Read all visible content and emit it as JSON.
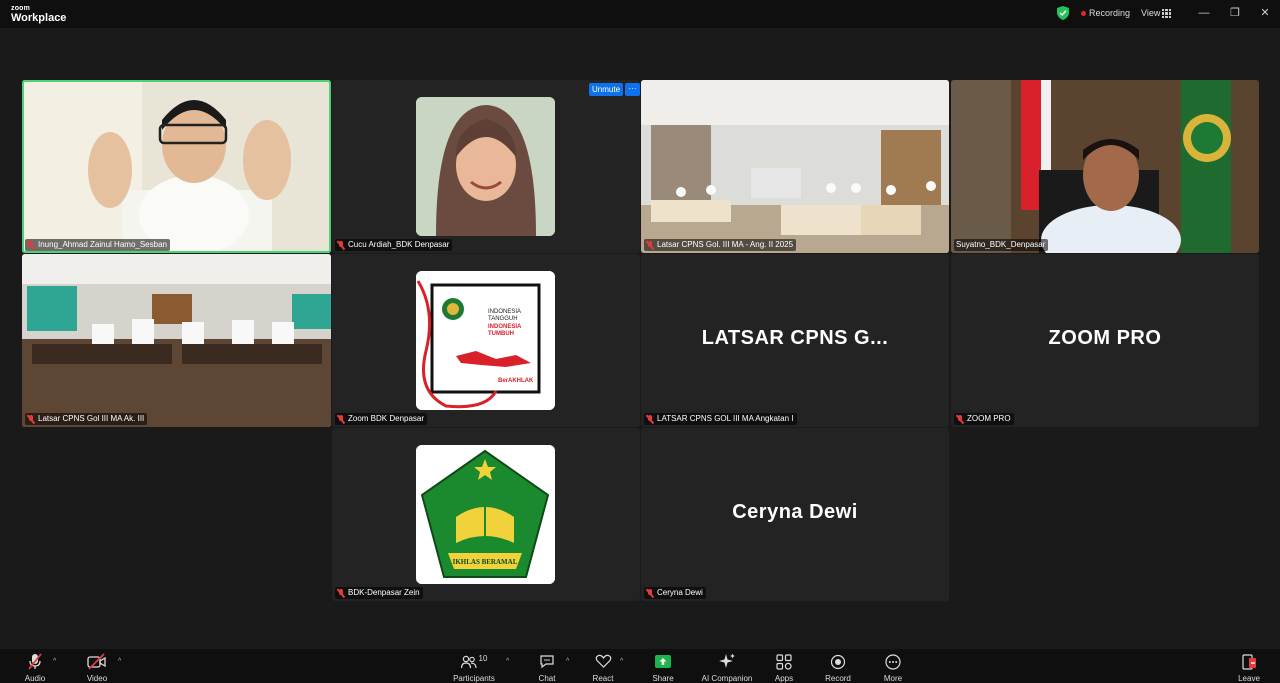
{
  "app": {
    "brand_small": "zoom",
    "brand_big": "Workplace"
  },
  "titlebar": {
    "recording_label": "Recording",
    "view_label": "View",
    "minimize": "—",
    "restore": "❐",
    "close": "✕"
  },
  "colors": {
    "active_border": "#4bd37b",
    "muted_red": "#e23b3b",
    "unmute_blue": "#0e72ed",
    "share_green": "#1fb34e"
  },
  "participants": [
    {
      "name": "Inung_Ahmad Zainul Hamo_Sesban"
    },
    {
      "name": "Cucu Ardiah_BDK Denpasar"
    },
    {
      "name": "Latsar CPNS Gol. III MA - Ang. II 2025"
    },
    {
      "name": "Suyatno_BDK_Denpasar"
    },
    {
      "name": "Latsar CPNS Gol III MA Ak. III"
    },
    {
      "name": "Zoom BDK Denpasar"
    },
    {
      "name": "LATSAR CPNS GOL III MA Angkatan I",
      "display": "LATSAR CPNS G..."
    },
    {
      "name": "ZOOM PRO",
      "display": "ZOOM PRO"
    },
    {
      "name": "BDK-Denpasar Zein"
    },
    {
      "name": "Ceryna Dewi",
      "display": "Ceryna Dewi"
    }
  ],
  "tile_controls": {
    "unmute_label": "Unmute",
    "more_label": "···"
  },
  "poster": {
    "line1": "INDONESIA",
    "line2": "TANGGUH",
    "line3": "INDONESIA",
    "line4": "TUMBUH",
    "tag": "BerAKHLAK"
  },
  "emblem": {
    "ribbon": "IKHLAS BERAMAL"
  },
  "toolbar": {
    "audio": "Audio",
    "video": "Video",
    "participants": "Participants",
    "participants_count": "10",
    "chat": "Chat",
    "react": "React",
    "share": "Share",
    "ai_companion": "AI Companion",
    "apps": "Apps",
    "record": "Record",
    "more": "More",
    "leave": "Leave"
  }
}
